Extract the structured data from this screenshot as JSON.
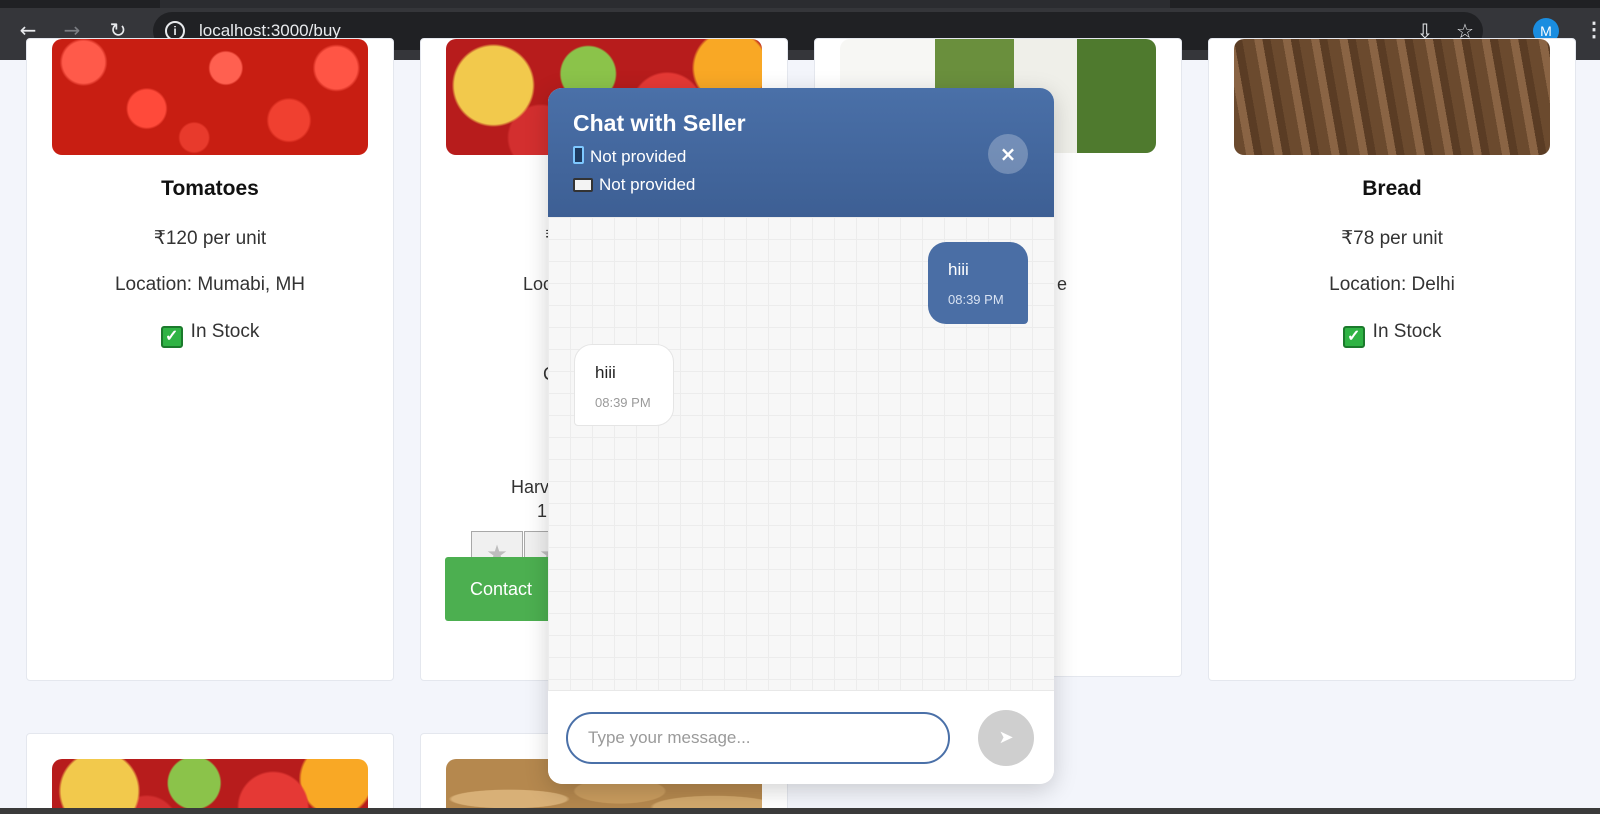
{
  "browser": {
    "url": "localhost:3000/buy",
    "profile_initial": "M",
    "icons": [
      "back-arrow-icon",
      "forward-arrow-icon",
      "reload-icon",
      "site-info-icon",
      "install-app-icon",
      "bookmark-star-icon",
      "more-vert-icon"
    ]
  },
  "products": [
    {
      "name": "Tomatoes",
      "price": "₹120 per unit",
      "location": "Location: Mumabi, MH",
      "stock": "In Stock"
    },
    {
      "partial_price": "₹",
      "partial_location": "Loc",
      "partial_text_c": "C",
      "partial_harvest": "Harv",
      "partial_harvest_date": "1",
      "contact_label": "Contact"
    },
    {
      "partial_location_tail": "e"
    },
    {
      "name": "Bread",
      "price": "₹78 per unit",
      "location": "Location: Delhi",
      "stock": "In Stock"
    }
  ],
  "chat": {
    "title": "Chat with Seller",
    "phone": "Not provided",
    "email": "Not provided",
    "close_label": "×",
    "messages": [
      {
        "text": "hiii",
        "time": "08:39 PM",
        "direction": "sent"
      },
      {
        "text": "hiii",
        "time": "08:39 PM",
        "direction": "received"
      }
    ],
    "input_placeholder": "Type your message...",
    "input_value": ""
  },
  "colors": {
    "chat_header": "#4a70a8",
    "sent_bubble": "#4a6ea5",
    "contact_button": "#4caf50",
    "page_bg": "#f3f5fb"
  }
}
